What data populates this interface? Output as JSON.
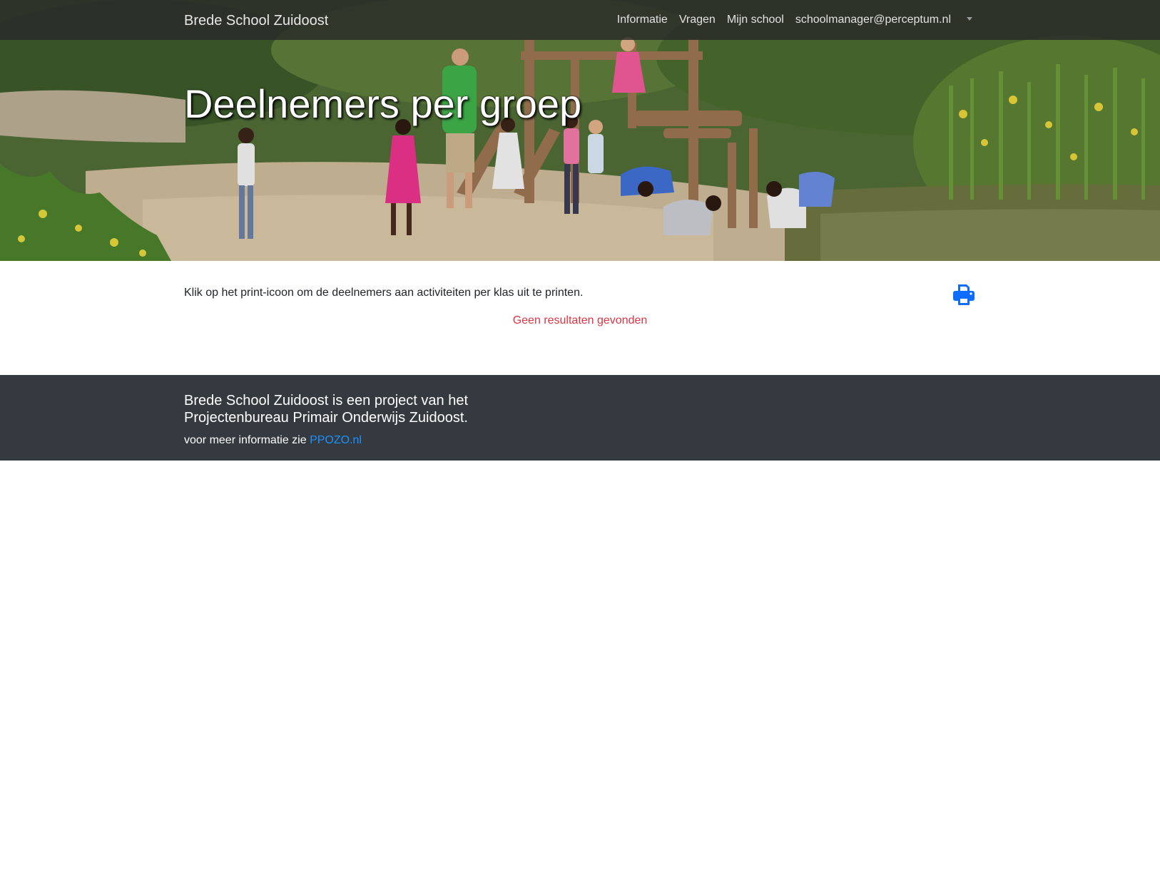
{
  "navbar": {
    "brand": "Brede School Zuidoost",
    "links": [
      {
        "label": "Informatie"
      },
      {
        "label": "Vragen"
      },
      {
        "label": "Mijn school"
      },
      {
        "label": "schoolmanager@perceptum.nl"
      }
    ]
  },
  "hero": {
    "title": "Deelnemers per groep"
  },
  "main": {
    "intro": "Klik op het print-icoon om de deelnemers aan activiteiten per klas uit te printen.",
    "print_icon": "print-icon",
    "no_results": "Geen resultaten gevonden"
  },
  "footer": {
    "heading": "Brede School Zuidoost is een project van het Projectenbureau Primair Onderwijs Zuidoost.",
    "info_prefix": "voor meer informatie zie",
    "link_label": "PPOZO.nl"
  },
  "colors": {
    "navbar_bg": "#282828",
    "footer_bg": "#343a40",
    "link_blue": "#1e90ff",
    "print_icon_blue": "#0d6efd",
    "no_results_red": "#dc3545"
  }
}
